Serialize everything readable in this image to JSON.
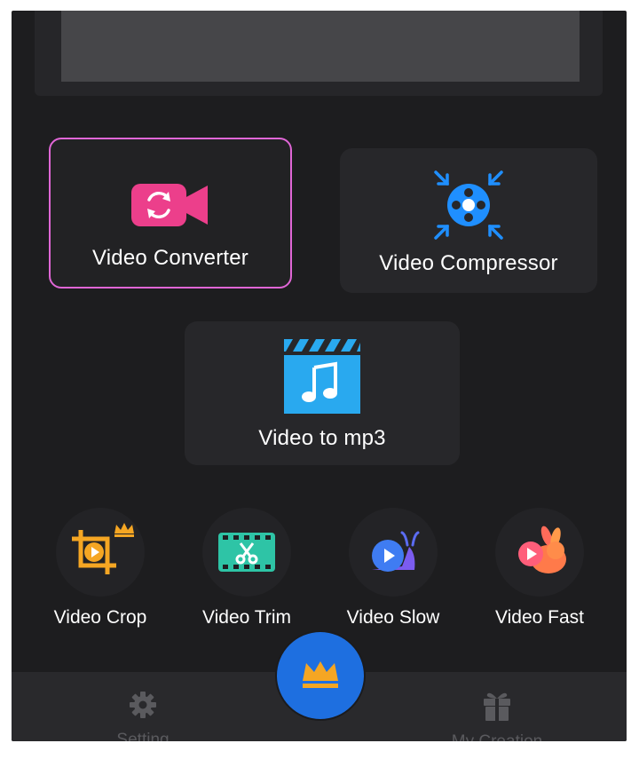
{
  "tools": {
    "converter": {
      "label": "Video Converter",
      "icon": "video-convert-icon",
      "color": "#ec3f8b"
    },
    "compressor": {
      "label": "Video Compressor",
      "icon": "compress-reel-icon",
      "color": "#1f8fff"
    },
    "mp3": {
      "label": "Video to mp3",
      "icon": "music-clapper-icon",
      "color": "#29a9ef"
    }
  },
  "small_tools": [
    {
      "label": "Video Crop",
      "icon": "crop-icon",
      "premium": true
    },
    {
      "label": "Video Trim",
      "icon": "trim-scissors-icon",
      "premium": false
    },
    {
      "label": "Video Slow",
      "icon": "snail-icon",
      "premium": false
    },
    {
      "label": "Video Fast",
      "icon": "rabbit-icon",
      "premium": false
    }
  ],
  "bottom_nav": {
    "setting": {
      "label": "Setting",
      "icon": "gear-icon"
    },
    "premium": {
      "icon": "crown-icon"
    },
    "creation": {
      "label": "My Creation",
      "icon": "gift-icon"
    }
  },
  "colors": {
    "selected_border": "#e066d6",
    "fab": "#1e6fe0",
    "crown": "#f5a623"
  }
}
